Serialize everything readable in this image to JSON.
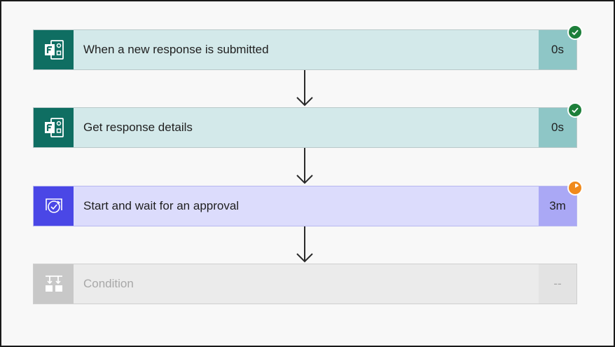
{
  "flow": {
    "steps": [
      {
        "icon": "forms-icon",
        "label": "When a new response is submitted",
        "duration": "0s",
        "status": "succeeded"
      },
      {
        "icon": "forms-icon",
        "label": "Get response details",
        "duration": "0s",
        "status": "succeeded"
      },
      {
        "icon": "approval-icon",
        "label": "Start and wait for an approval",
        "duration": "3m",
        "status": "running"
      },
      {
        "icon": "condition-icon",
        "label": "Condition",
        "duration": "--",
        "status": "not-run"
      }
    ]
  },
  "colors": {
    "forms_accent": "#0f6e62",
    "approval_accent": "#4a47e6",
    "success": "#1d7f3a",
    "running": "#f08a1c",
    "disabled": "#c8c8c8"
  }
}
